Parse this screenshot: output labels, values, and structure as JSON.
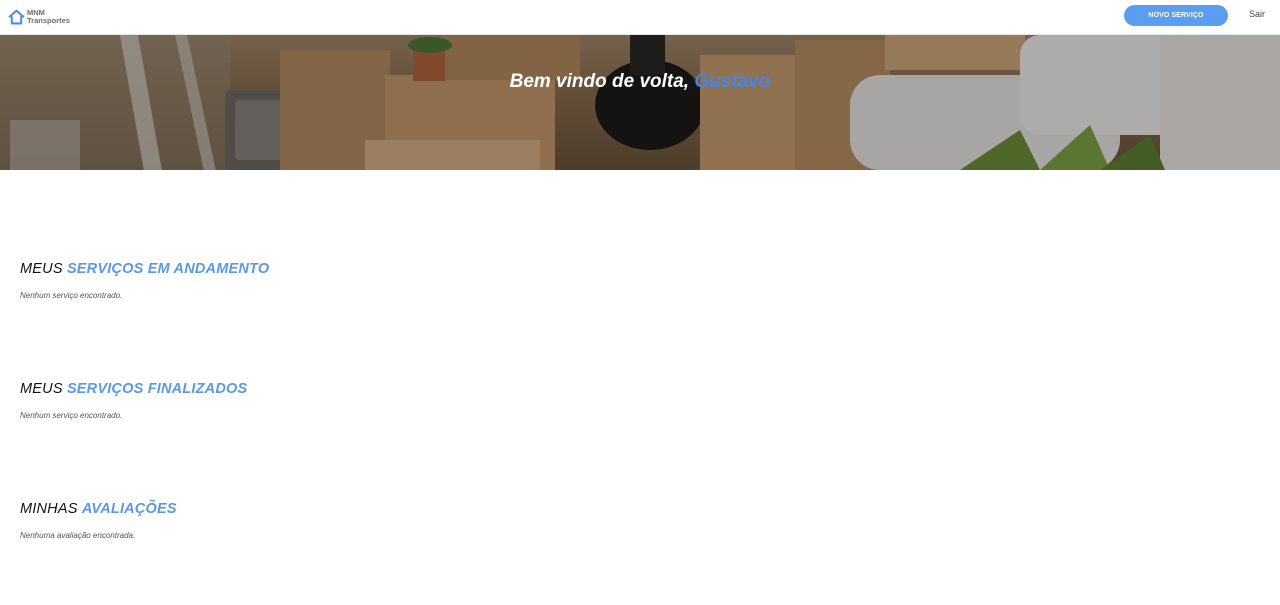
{
  "header": {
    "logo_line1": "MNM",
    "logo_line2": "Transportes",
    "new_service_label": "NOVO SERVIÇO",
    "logout_label": "Sair"
  },
  "hero": {
    "welcome_text": "Bem vindo de volta,",
    "user_name": "Gustavo"
  },
  "sections": [
    {
      "prefix": "MEUS",
      "accent": "SERVIÇOS EM ANDAMENTO",
      "empty_text": "Nenhum serviço encontrado."
    },
    {
      "prefix": "MEUS",
      "accent": "SERVIÇOS FINALIZADOS",
      "empty_text": "Nenhum serviço encontrado."
    },
    {
      "prefix": "MINHAS",
      "accent": "AVALIAÇÕES",
      "empty_text": "Nenhuma avaliação encontrada."
    }
  ],
  "colors": {
    "accent": "#5b9ae0",
    "button": "#5b9df0",
    "user_name": "#3f86ee"
  },
  "icons": {
    "logo": "house-icon"
  }
}
